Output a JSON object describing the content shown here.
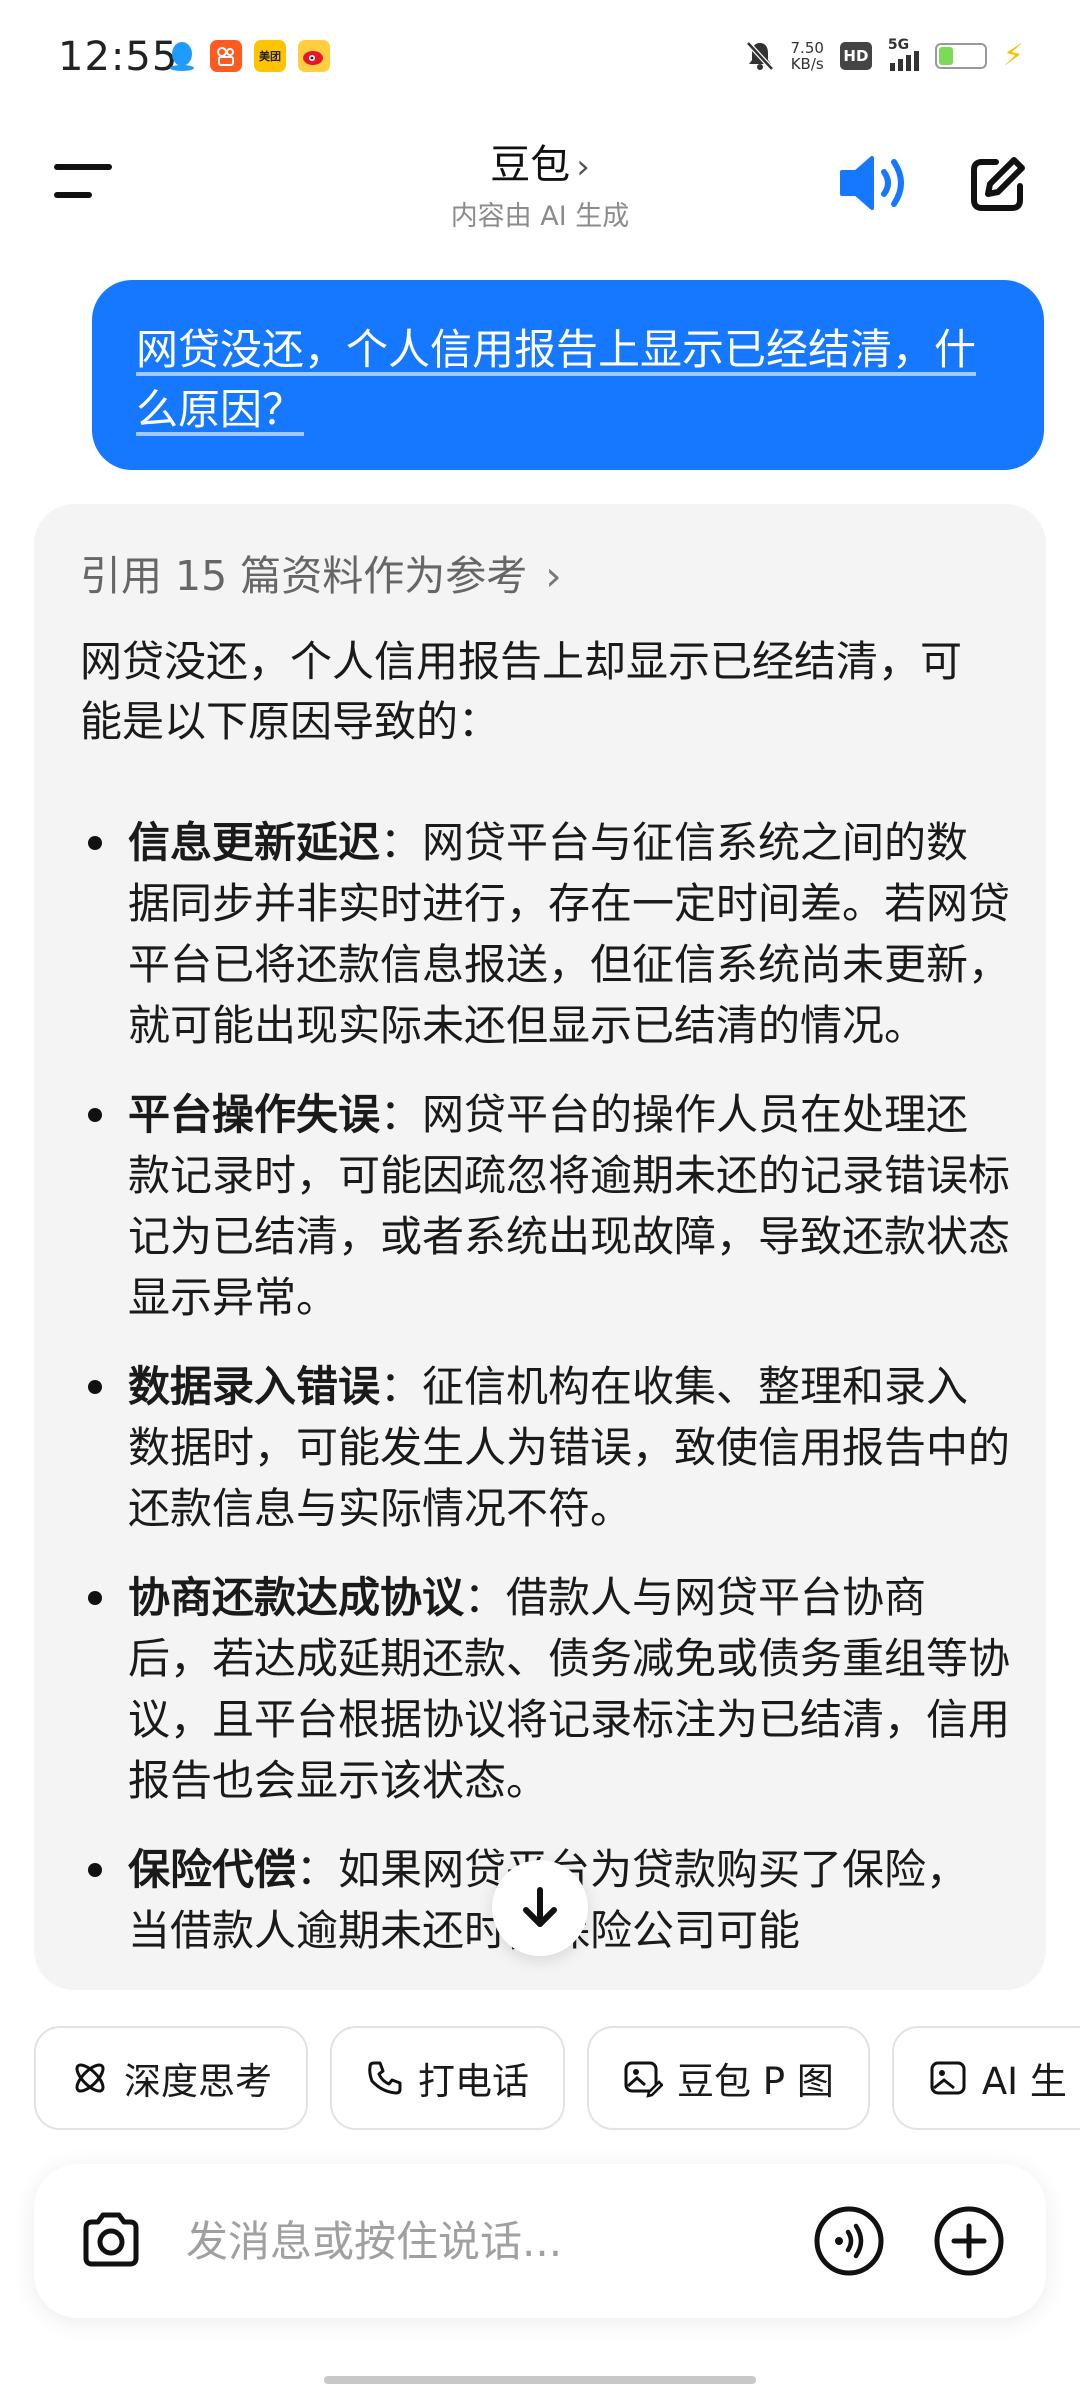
{
  "status_bar": {
    "time": "12:55",
    "apps": [
      {
        "name": "qq",
        "color": "#1e9bff",
        "glyph": "🐧"
      },
      {
        "name": "kuaishou",
        "color": "#ff5a1f",
        "glyph": "快"
      },
      {
        "name": "meituan",
        "color": "#ffc300",
        "glyph": "美团"
      },
      {
        "name": "weibo",
        "color": "#ffcf3f",
        "glyph": "微"
      }
    ],
    "net_speed_value": "7.50",
    "net_speed_unit": "KB/s",
    "hd_badge": "HD",
    "network": "5G",
    "battery_fraction": 0.3
  },
  "header": {
    "title": "豆包",
    "subtitle": "内容由 AI 生成"
  },
  "conversation": {
    "user_message": "网贷没还，个人信用报告上显示已经结清，什么原因？",
    "answer": {
      "references_label": "引用 15 篇资料作为参考",
      "intro": "网贷没还，个人信用报告上却显示已经结清，可能是以下原因导致的：",
      "items": [
        {
          "title": "信息更新延迟",
          "text": "：网贷平台与征信系统之间的数据同步并非实时进行，存在一定时间差。若网贷平台已将还款信息报送，但征信系统尚未更新，就可能出现实际未还但显示已结清的情况。"
        },
        {
          "title": "平台操作失误",
          "text": "：网贷平台的操作人员在处理还款记录时，可能因疏忽将逾期未还的记录错误标记为已结清，或者系统出现故障，导致还款状态显示异常。"
        },
        {
          "title": "数据录入错误",
          "text": "：征信机构在收集、整理和录入数据时，可能发生人为错误，致使信用报告中的还款信息与实际情况不符。"
        },
        {
          "title": "协商还款达成协议",
          "text": "：借款人与网贷平台协商后，若达成延期还款、债务减免或债务重组等协议，且平台根据协议将记录标注为已结清，信用报告也会显示该状态。"
        },
        {
          "title": "保险代偿",
          "text": "：如果网贷平台为贷款购买了保险，当借款人逾期未还时，保险公司可能"
        }
      ]
    }
  },
  "quick_actions": [
    {
      "label": "深度思考",
      "icon": "atom-icon"
    },
    {
      "label": "打电话",
      "icon": "phone-icon"
    },
    {
      "label": "豆包 P 图",
      "icon": "image-edit-icon"
    },
    {
      "label": "AI 生",
      "icon": "image-icon"
    }
  ],
  "input": {
    "placeholder": "发消息或按住说话..."
  },
  "colors": {
    "accent": "#1677ff",
    "card_bg": "#f4f4f5"
  }
}
